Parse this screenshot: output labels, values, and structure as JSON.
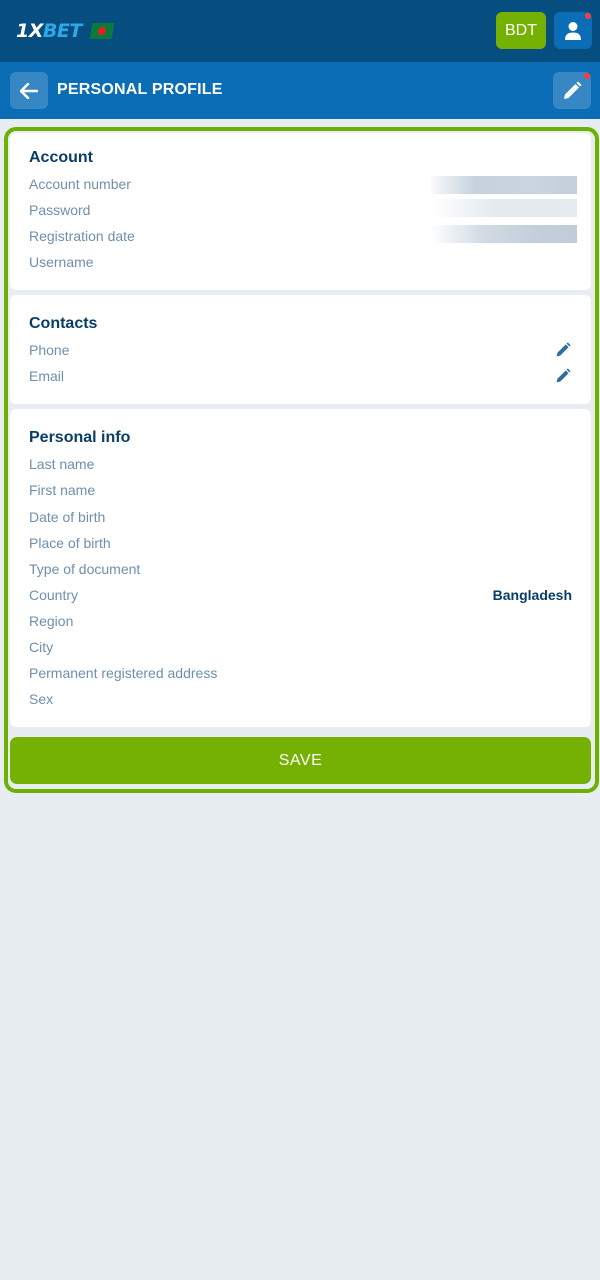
{
  "header": {
    "logo": {
      "part1": "1X",
      "part2": "BET"
    },
    "currency_label": "BDT",
    "colors": {
      "topbar": "#064e80",
      "subbar": "#0a6db6",
      "accent_green": "#74b103",
      "notify": "#ff3b3b"
    }
  },
  "subheader": {
    "title": "PERSONAL PROFILE",
    "back_icon": "arrow-left-icon",
    "edit_icon": "pencil-icon"
  },
  "account": {
    "title": "Account",
    "fields": [
      {
        "label": "Account number"
      },
      {
        "label": "Password"
      },
      {
        "label": "Registration date"
      },
      {
        "label": "Username"
      }
    ]
  },
  "contacts": {
    "title": "Contacts",
    "fields": [
      {
        "label": "Phone",
        "icon": "pencil-icon"
      },
      {
        "label": "Email",
        "icon": "pencil-icon"
      }
    ]
  },
  "personal": {
    "title": "Personal info",
    "fields": [
      {
        "label": "Last name",
        "value": ""
      },
      {
        "label": "First name",
        "value": ""
      },
      {
        "label": "Date of birth",
        "value": ""
      },
      {
        "label": "Place of birth",
        "value": ""
      },
      {
        "label": "Type of document",
        "value": ""
      },
      {
        "label": "Country",
        "value": "Bangladesh"
      },
      {
        "label": "Region",
        "value": ""
      },
      {
        "label": "City",
        "value": ""
      },
      {
        "label": "Permanent registered address",
        "value": ""
      },
      {
        "label": "Sex",
        "value": ""
      }
    ]
  },
  "actions": {
    "save_label": "SAVE"
  }
}
